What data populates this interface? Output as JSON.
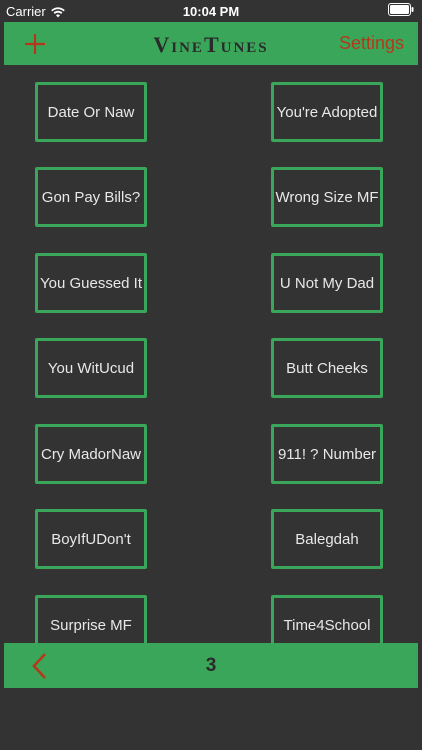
{
  "status_bar": {
    "carrier": "Carrier",
    "time": "10:04 PM",
    "icons": [
      "wifi-icon",
      "battery-icon"
    ]
  },
  "nav_bar": {
    "add_icon": "plus-icon",
    "title": "VineTunes",
    "settings_label": "Settings"
  },
  "sound_buttons": [
    "Date Or Naw",
    "You're Adopted",
    "Gon Pay Bills?",
    "Wrong Size MF",
    "You Guessed It",
    "U Not My Dad",
    "You WitUcud",
    "Butt Cheeks",
    "Cry MadorNaw",
    "911! ? Number",
    "BoyIfUDon't",
    "Balegdah",
    "Surprise MF",
    "Time4School"
  ],
  "bottom_bar": {
    "back_icon": "chevron-left-icon",
    "page_number": "3"
  },
  "colors": {
    "background": "#333333",
    "accent_green": "#3aa65a",
    "accent_red": "#b5381c",
    "title_dark": "#2a2a2a",
    "button_text": "#e8e8e8"
  }
}
